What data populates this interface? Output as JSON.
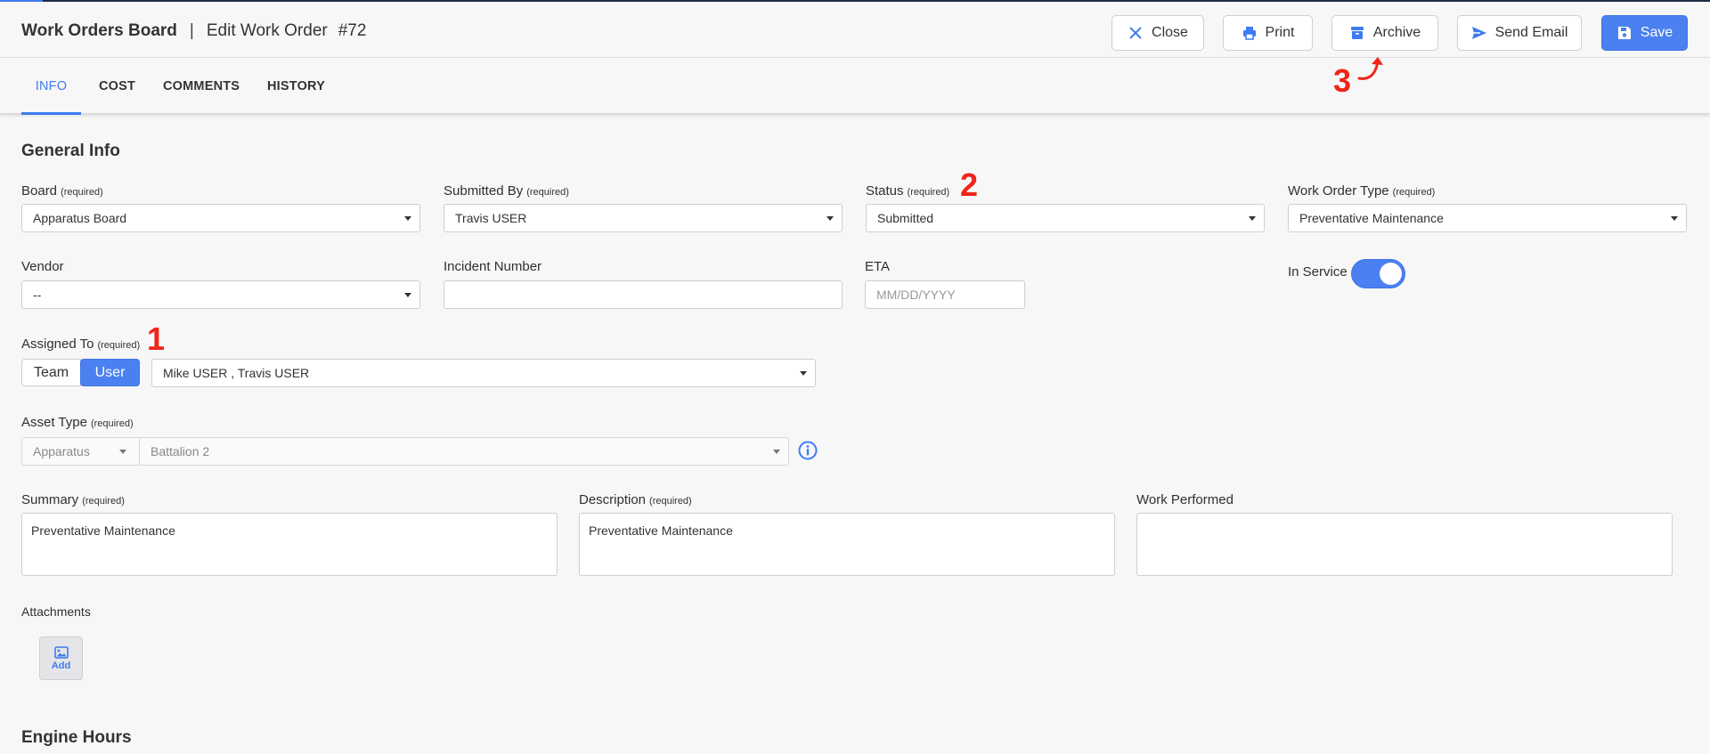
{
  "header": {
    "app_title": "Work Orders Board",
    "separator": "|",
    "page_title": "Edit Work Order",
    "order_number": "#72",
    "buttons": {
      "close": "Close",
      "print": "Print",
      "archive": "Archive",
      "send_email": "Send Email",
      "save": "Save"
    }
  },
  "tabs": [
    {
      "label": "INFO",
      "active": true
    },
    {
      "label": "COST",
      "active": false
    },
    {
      "label": "COMMENTS",
      "active": false
    },
    {
      "label": "HISTORY",
      "active": false
    }
  ],
  "general_info": {
    "section_title": "General Info",
    "required_note": "(required)",
    "board": {
      "label": "Board",
      "value": "Apparatus Board"
    },
    "submitted_by": {
      "label": "Submitted By",
      "value": "Travis USER"
    },
    "status": {
      "label": "Status",
      "value": "Submitted"
    },
    "work_order_type": {
      "label": "Work Order Type",
      "value": "Preventative Maintenance"
    },
    "vendor": {
      "label": "Vendor",
      "value": "--"
    },
    "incident_number": {
      "label": "Incident Number",
      "value": ""
    },
    "eta": {
      "label": "ETA",
      "placeholder": "MM/DD/YYYY"
    },
    "in_service": {
      "label": "In Service",
      "on": true
    },
    "assigned_to": {
      "label": "Assigned To",
      "team_label": "Team",
      "user_label": "User",
      "selected_mode": "User",
      "value": "Mike USER , Travis USER"
    },
    "asset_type": {
      "label": "Asset Type",
      "category": "Apparatus",
      "value": "Battalion 2"
    },
    "summary": {
      "label": "Summary",
      "value": "Preventative Maintenance"
    },
    "description": {
      "label": "Description",
      "value": "Preventative Maintenance"
    },
    "work_performed": {
      "label": "Work Performed",
      "value": ""
    },
    "attachments": {
      "label": "Attachments",
      "add_label": "Add"
    }
  },
  "engine_hours": {
    "section_title": "Engine Hours"
  },
  "annotations": [
    "1",
    "2",
    "3"
  ],
  "colors": {
    "accent": "#4a80f0",
    "annotation": "#f02418"
  }
}
